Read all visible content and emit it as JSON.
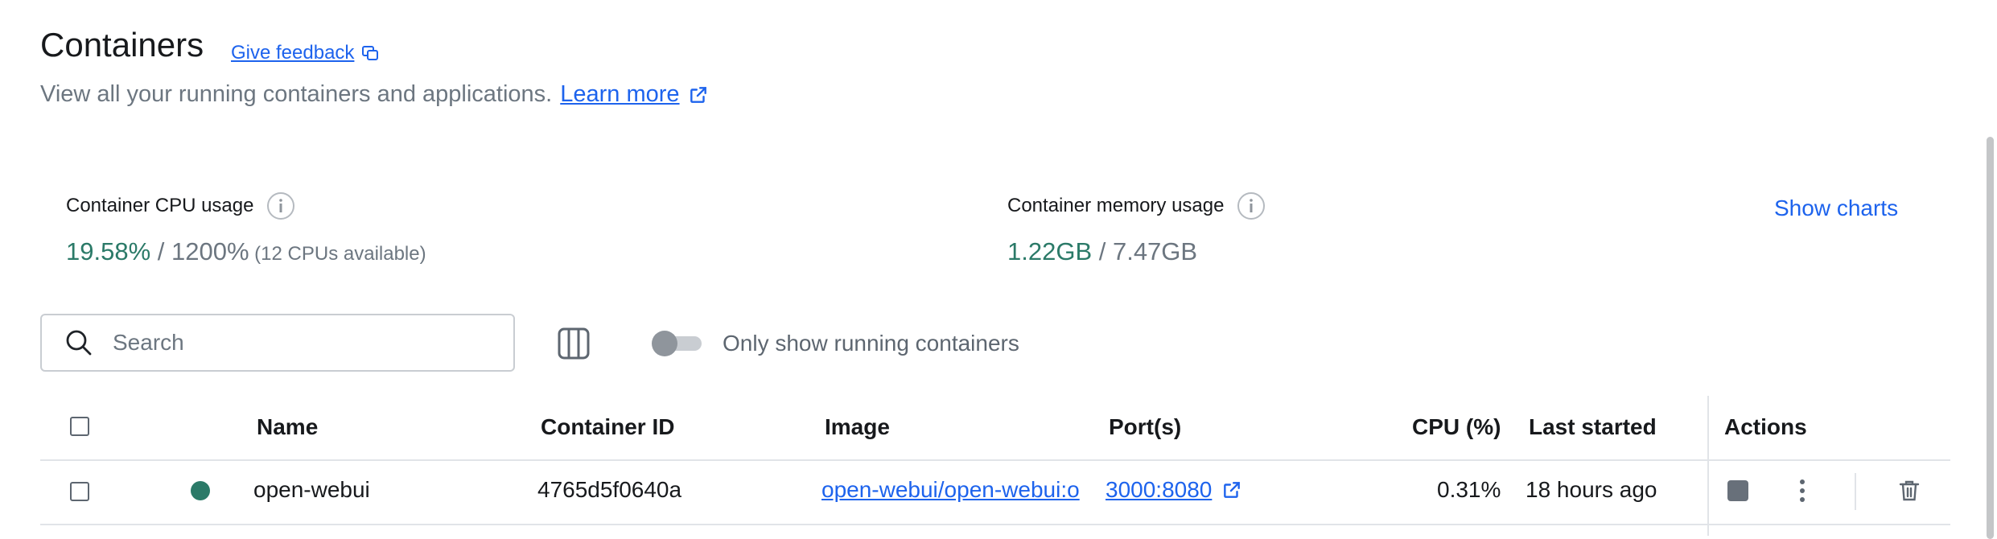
{
  "header": {
    "title": "Containers",
    "feedback_label": "Give feedback",
    "subtitle": "View all your running containers and applications.",
    "learn_more_label": "Learn more"
  },
  "stats": {
    "cpu": {
      "label": "Container CPU usage",
      "value": "19.58%",
      "total": " / 1200%",
      "note": " (12 CPUs available)"
    },
    "memory": {
      "label": "Container memory usage",
      "value": "1.22GB",
      "total": " / 7.47GB"
    },
    "show_charts_label": "Show charts"
  },
  "filters": {
    "search_placeholder": "Search",
    "running_toggle_label": "Only show running containers",
    "running_toggle_on": false
  },
  "table": {
    "columns": [
      "Name",
      "Container ID",
      "Image",
      "Port(s)",
      "CPU (%)",
      "Last started",
      "Actions"
    ],
    "rows": [
      {
        "name": "open-webui",
        "status": "running",
        "container_id": "4765d5f0640a",
        "image": "open-webui/open-webui:o",
        "ports": "3000:8080",
        "cpu": "0.31%",
        "last_started": "18 hours ago"
      }
    ]
  },
  "colors": {
    "accent": "#1d63ed",
    "running": "#2b7a68",
    "muted": "#6c7680"
  }
}
